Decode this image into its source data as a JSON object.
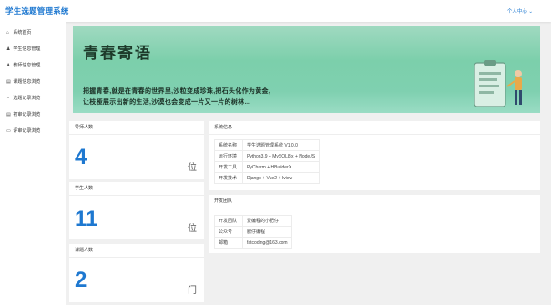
{
  "header": {
    "title": "学生选题管理系统",
    "user_menu": "个人中心 ⌄"
  },
  "sidebar": {
    "items": [
      {
        "icon": "home-icon",
        "glyph": "⌂",
        "label": "系统首页"
      },
      {
        "icon": "users-icon",
        "glyph": "♟",
        "label": "学生信息管理"
      },
      {
        "icon": "person-icon",
        "glyph": "♟",
        "label": "教师信息管理"
      },
      {
        "icon": "topic-icon",
        "glyph": "▤",
        "label": "课题信息浏览"
      },
      {
        "icon": "record-icon",
        "glyph": "◔",
        "label": "选题记录浏览"
      },
      {
        "icon": "review-icon",
        "glyph": "▤",
        "label": "初审记录浏览"
      },
      {
        "icon": "score-icon",
        "glyph": "▭",
        "label": "评审记录浏览"
      }
    ]
  },
  "banner": {
    "title": "青春寄语",
    "line1": "把握青春,就是在青春的世界里,沙粒变成珍珠,把石头化作为黄金,",
    "line2": "让枝桠展示出新的生活,沙漠也会变成一片又一片的树林…"
  },
  "stats": [
    {
      "label": "导师人数",
      "value": "4",
      "unit": "位"
    },
    {
      "label": "学生人数",
      "value": "11",
      "unit": "位"
    },
    {
      "label": "课题人数",
      "value": "2",
      "unit": "门"
    }
  ],
  "system_info": {
    "title": "系统信息",
    "rows": [
      {
        "key": "系统名称",
        "value": "学生选题管理系统 V1.0.0"
      },
      {
        "key": "运行环境",
        "value": "Python3.9 + MySQL8.x + NodeJS"
      },
      {
        "key": "开发工具",
        "value": "PyCharm + HBuilderX"
      },
      {
        "key": "开发技术",
        "value": "Django + Vue2 + Iview"
      }
    ]
  },
  "dev_team": {
    "title": "开发团队",
    "rows": [
      {
        "key": "开发团队",
        "value": "爱编程的小肥仔"
      },
      {
        "key": "公众号",
        "value": "肥仔编程"
      },
      {
        "key": "邮箱",
        "value": "fatcoding@163.com"
      }
    ]
  },
  "colors": {
    "accent": "#1e78d0",
    "banner": "#7ccfab"
  }
}
